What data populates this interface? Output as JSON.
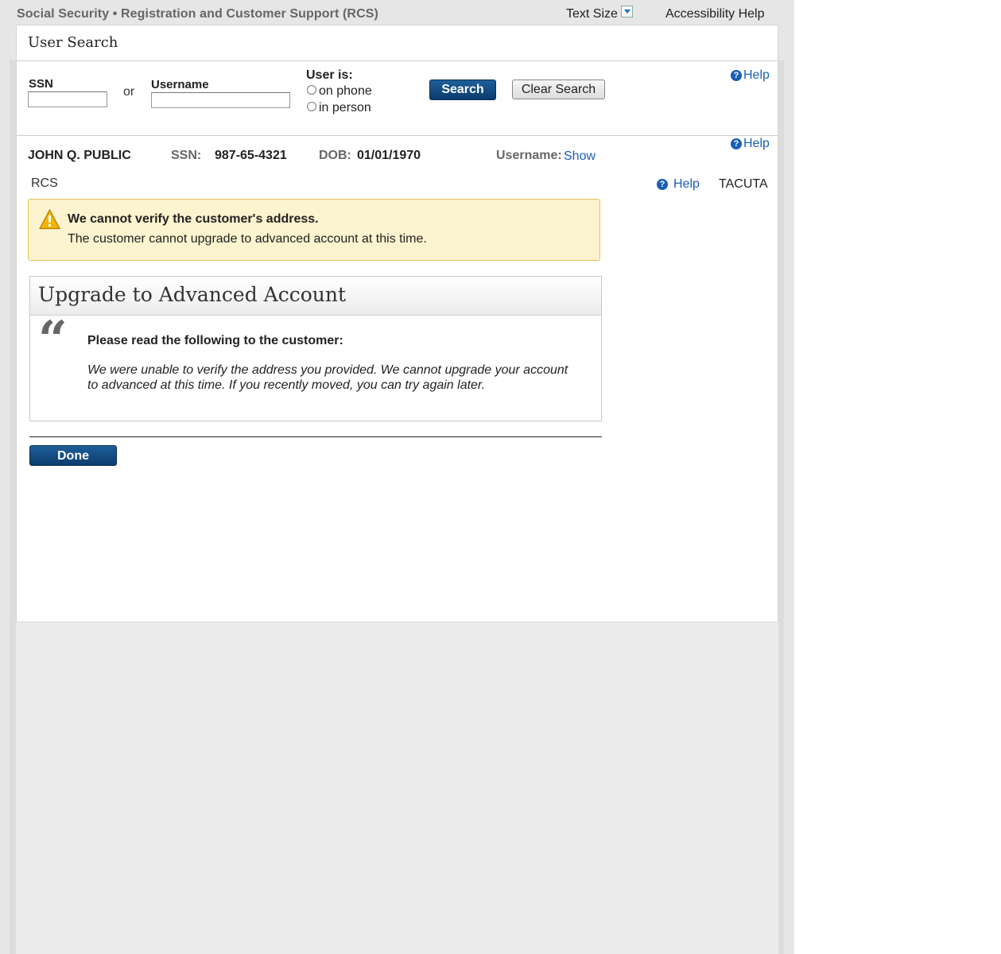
{
  "topbar": {
    "title": "Social Security • Registration and Customer Support (RCS)",
    "text_size": "Text Size",
    "accessibility_help": "Accessibility Help"
  },
  "user_search": {
    "title": "User Search",
    "ssn_label": "SSN",
    "ssn_value": "",
    "or_label": "or",
    "username_label": "Username",
    "username_value": "",
    "user_is_label": "User is:",
    "options": [
      "on phone",
      "in person"
    ],
    "search_button": "Search",
    "clear_button": "Clear Search",
    "help": "Help"
  },
  "customer": {
    "name": "JOHN Q. PUBLIC",
    "ssn_label": "SSN:",
    "ssn_value": "987-65-4321",
    "dob_label": "DOB:",
    "dob_value": "01/01/1970",
    "username_label": "Username:",
    "username_link": "Show",
    "help": "Help"
  },
  "context": {
    "app": "RCS",
    "help": "Help",
    "user_id": "TACUTA"
  },
  "warning": {
    "heading": "We cannot verify the customer's address.",
    "text": "The customer cannot upgrade to advanced account at this time."
  },
  "upgrade": {
    "title": "Upgrade to Advanced Account",
    "quote_mark": "“",
    "instruction": "Please read the following to the customer:",
    "script": "We were unable to verify the address you provided. We cannot upgrade your account to advanced at this time. If you recently moved, you can try again later."
  },
  "done_button": "Done",
  "colors": {
    "primary_button": "#0b3c6d",
    "link": "#1a5fb4",
    "warning_bg": "#fcf3cf",
    "warning_border": "#e1c25a"
  }
}
